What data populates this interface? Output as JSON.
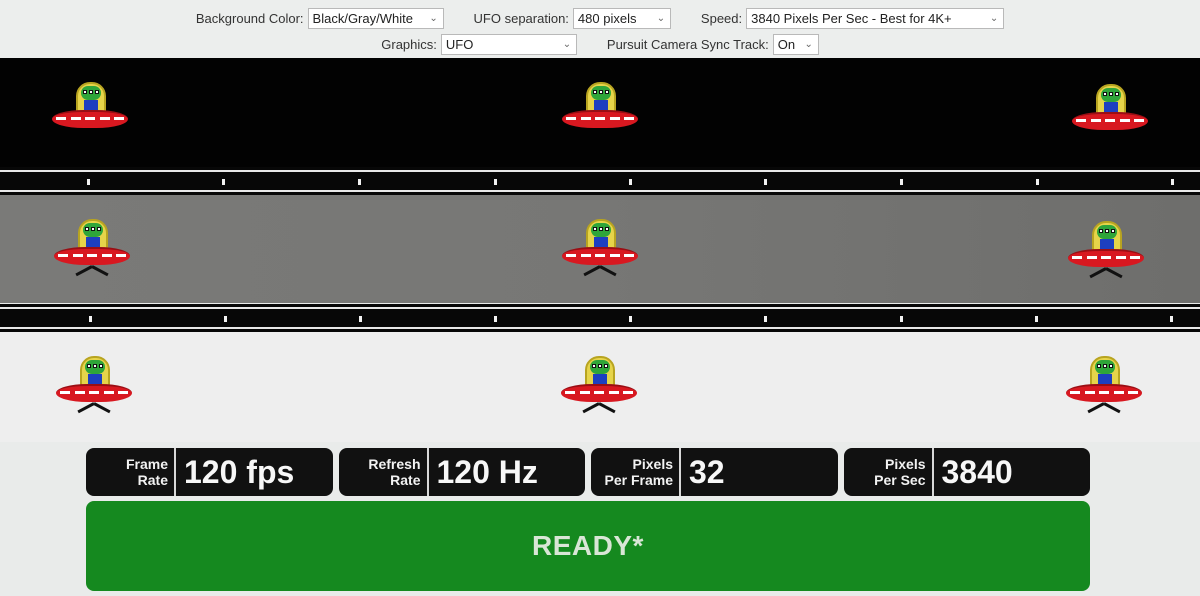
{
  "controls": {
    "background_color": {
      "label": "Background Color:",
      "value": "Black/Gray/White"
    },
    "ufo_separation": {
      "label": "UFO separation:",
      "value": "480 pixels"
    },
    "speed": {
      "label": "Speed:",
      "value": "3840 Pixels Per Sec - Best for 4K+"
    },
    "graphics": {
      "label": "Graphics:",
      "value": "UFO"
    },
    "pursuit_sync": {
      "label": "Pursuit Camera Sync Track:",
      "value": "On"
    }
  },
  "bands": [
    {
      "name": "black",
      "color": "#020202"
    },
    {
      "name": "gray",
      "color": "#777775"
    },
    {
      "name": "white",
      "color": "#eeeeee"
    }
  ],
  "icons": {
    "ufo": "ufo-icon",
    "dropdown": "chevron-down-icon"
  },
  "stats": {
    "frame_rate": {
      "label": "Frame\nRate",
      "value": "120 fps"
    },
    "refresh_rate": {
      "label": "Refresh\nRate",
      "value": "120 Hz"
    },
    "pixels_per_frame": {
      "label": "Pixels\nPer Frame",
      "value": "32"
    },
    "pixels_per_sec": {
      "label": "Pixels\nPer Sec",
      "value": "3840"
    }
  },
  "status": {
    "text": "READY*",
    "color": "#15891f"
  }
}
